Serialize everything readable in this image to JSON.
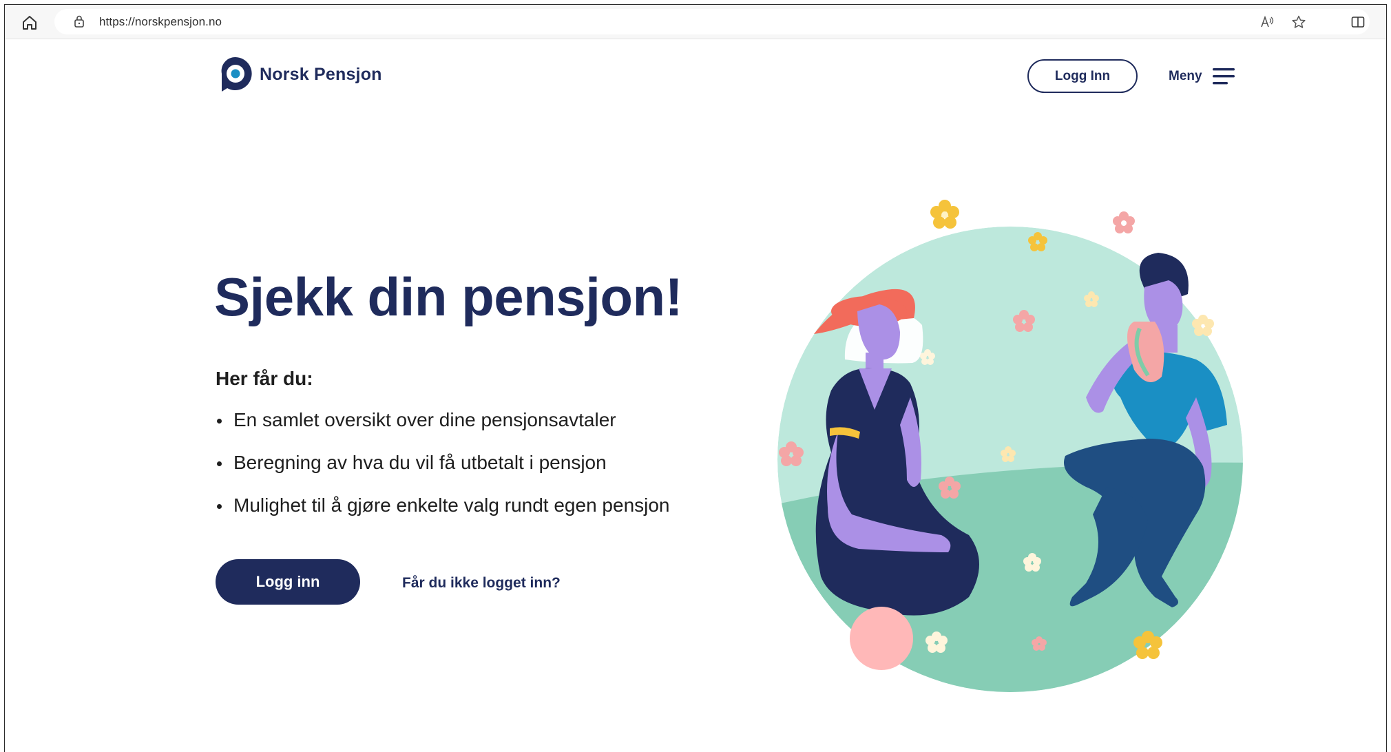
{
  "browser": {
    "url": "https://norskpensjon.no",
    "icons": [
      "home-icon",
      "lock-icon",
      "read-aloud-icon",
      "favorite-star-icon",
      "split-screen-icon"
    ]
  },
  "header": {
    "brand": "Norsk Pensjon",
    "login_label": "Logg Inn",
    "menu_label": "Meny"
  },
  "hero": {
    "title": "Sjekk din pensjon!",
    "subheading": "Her får du:",
    "benefits": [
      "En samlet oversikt over dine pensjonsavtaler",
      "Beregning av hva du vil få utbetalt i pensjon",
      "Mulighet til å gjøre enkelte valg rundt egen pensjon"
    ],
    "cta_label": "Logg inn",
    "help_link": "Får du ikke logget inn?"
  },
  "colors": {
    "navy": "#1f2b5c",
    "circle_light": "#bde8dc",
    "circle_ground": "#86cdb5",
    "flower_yellow": "#f5c33b",
    "flower_pink": "#f4a6a6",
    "hat": "#f26b5b",
    "skin": "#ab90e6",
    "shirt_blue": "#1a8fc4"
  }
}
